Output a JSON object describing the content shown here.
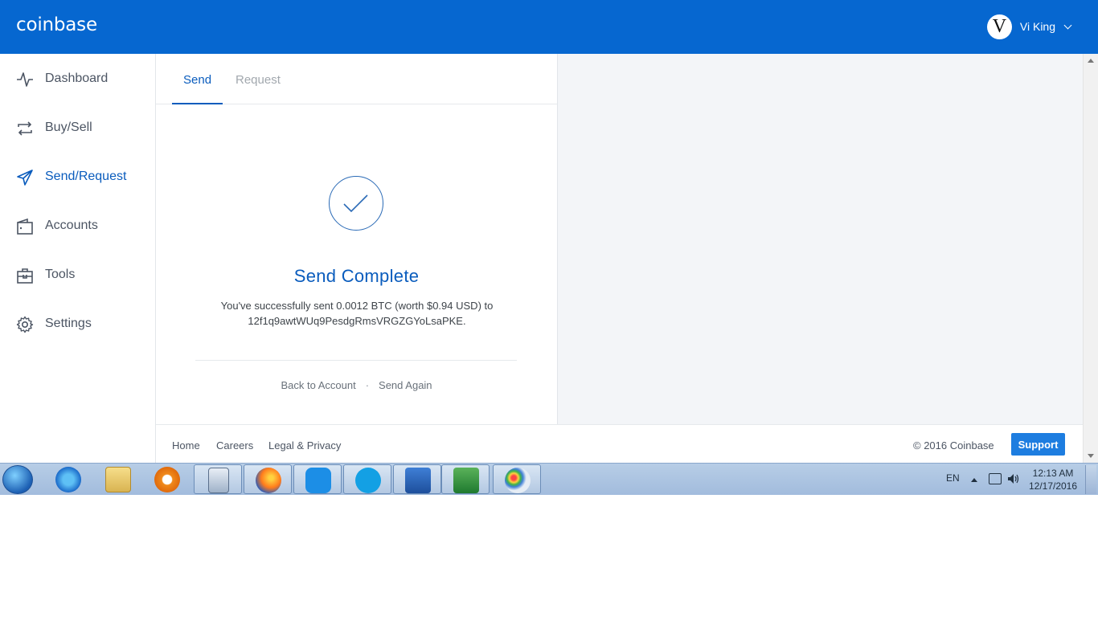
{
  "header": {
    "logo": "coinbase",
    "user_initial": "V",
    "user_name": "Vi King"
  },
  "sidebar": {
    "items": [
      {
        "label": "Dashboard",
        "icon": "activity-icon",
        "active": false
      },
      {
        "label": "Buy/Sell",
        "icon": "exchange-icon",
        "active": false
      },
      {
        "label": "Send/Request",
        "icon": "paper-plane-icon",
        "active": true
      },
      {
        "label": "Accounts",
        "icon": "wallet-icon",
        "active": false
      },
      {
        "label": "Tools",
        "icon": "toolbox-icon",
        "active": false
      },
      {
        "label": "Settings",
        "icon": "gear-icon",
        "active": false
      }
    ]
  },
  "panel": {
    "tabs": {
      "send": "Send",
      "request": "Request"
    },
    "title": "Send Complete",
    "message_line1": "You've successfully sent 0.0012 BTC (worth $0.94 USD) to",
    "message_line2": "12f1q9awtWUq9PesdgRmsVRGZGYoLsaPKE.",
    "back_link": "Back to Account",
    "separator": "·",
    "send_again_link": "Send Again"
  },
  "footer": {
    "links": [
      "Home",
      "Careers",
      "Legal & Privacy"
    ],
    "copyright": "© 2016 Coinbase",
    "support_label": "Support"
  },
  "taskbar": {
    "apps": [
      "internet-explorer-icon",
      "file-explorer-icon",
      "media-player-icon",
      "calculator-icon",
      "firefox-icon",
      "zalo-icon",
      "skype-icon",
      "word-icon",
      "excel-icon",
      "paint-icon"
    ],
    "language": "EN",
    "time": "12:13 AM",
    "date": "12/17/2016"
  },
  "colors": {
    "brand_blue": "#0667d0",
    "link_blue": "#0a5cbd",
    "support_blue": "#1d7de0"
  }
}
